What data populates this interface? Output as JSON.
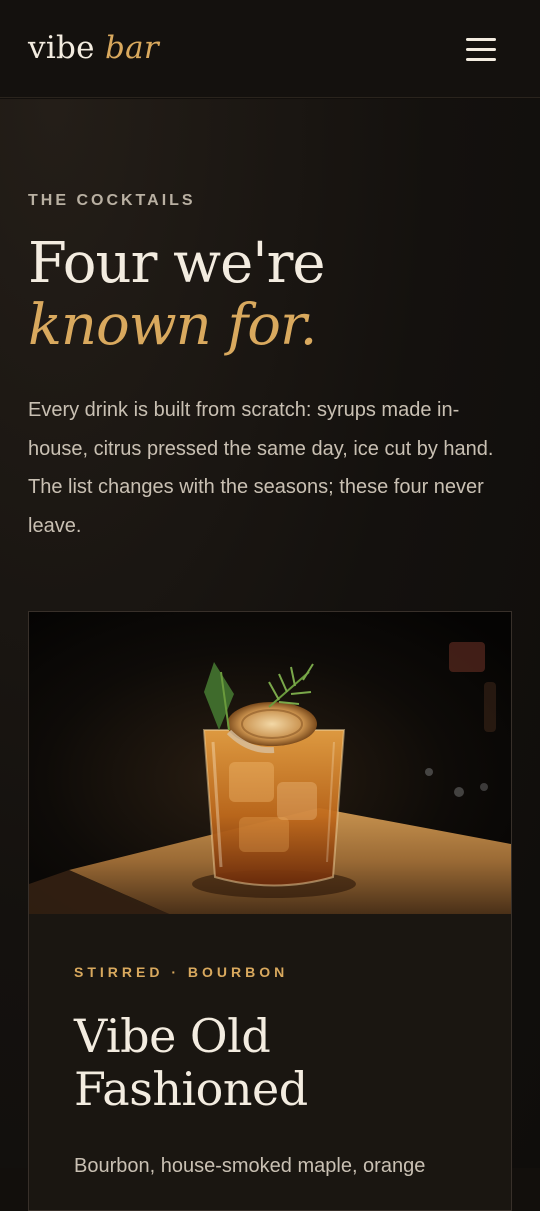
{
  "header": {
    "logo_main": "vibe",
    "logo_accent": "bar",
    "menu_icon": "hamburger-menu-icon"
  },
  "section": {
    "eyebrow": "THE COCKTAILS",
    "headline_main": "Four we're",
    "headline_accent": "known for.",
    "intro": "Every drink is built from scratch: syrups made in-house, citrus pressed the same day, ice cut by hand. The list changes with the seasons; these four never leave."
  },
  "cards": [
    {
      "image": "cocktail-photo",
      "meta": "STIRRED · BOURBON",
      "title": "Vibe Old Fashioned",
      "description": "Bourbon, house-smoked maple, orange"
    }
  ],
  "colors": {
    "background": "#120f0c",
    "accent": "#d9a95e",
    "text": "#f3ece0",
    "muted": "#c9c0b3"
  }
}
